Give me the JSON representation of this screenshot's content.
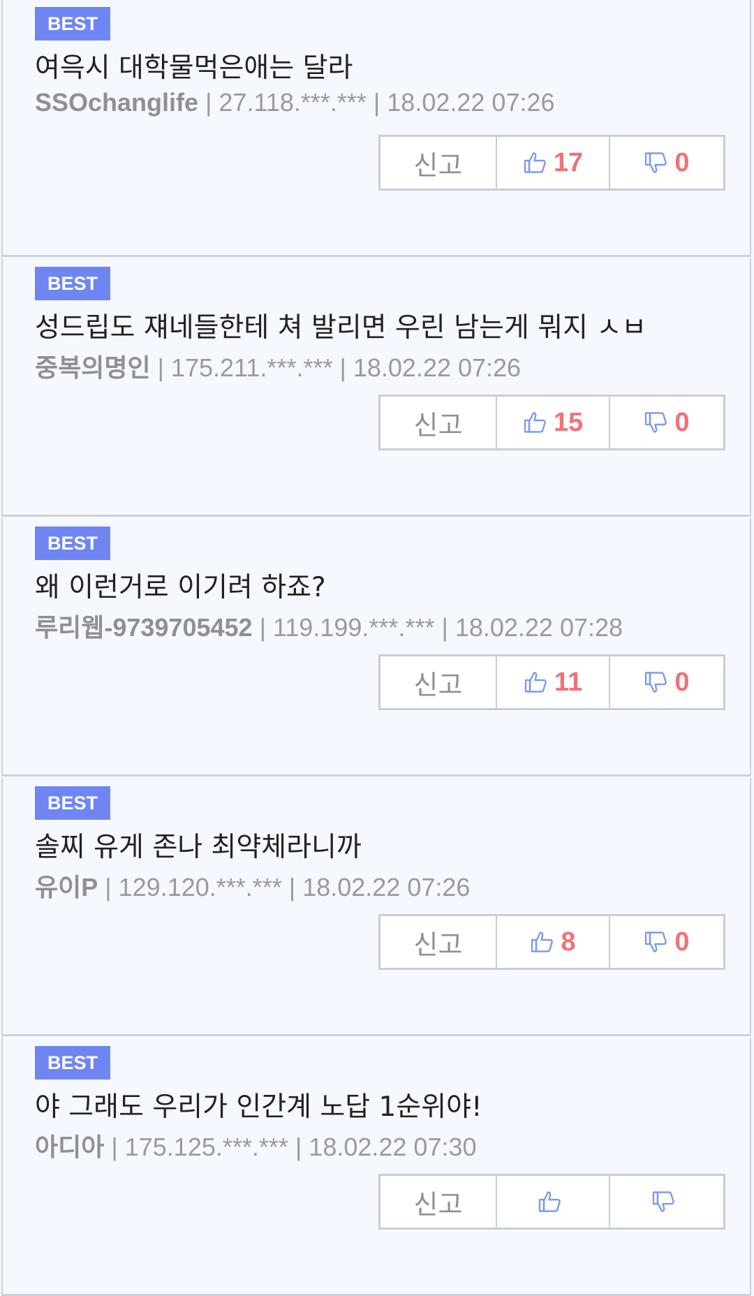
{
  "comments": [
    {
      "badge": "BEST",
      "text": "여윽시 대학물먹은애는 달라",
      "author": "SSOchanglife",
      "ip": "27.118.***.***",
      "date": "18.02.22 07:26",
      "report_label": "신고",
      "likes": "17",
      "dislikes": "0"
    },
    {
      "badge": "BEST",
      "text": "성드립도 쟤네들한테 쳐 발리면 우린 남는게 뭐지 ㅅㅂ",
      "author": "중복의명인",
      "ip": "175.211.***.***",
      "date": "18.02.22 07:26",
      "report_label": "신고",
      "likes": "15",
      "dislikes": "0"
    },
    {
      "badge": "BEST",
      "text": "왜 이런거로 이기려 하죠?",
      "author": "루리웹-9739705452",
      "ip": "119.199.***.***",
      "date": "18.02.22 07:28",
      "report_label": "신고",
      "likes": "11",
      "dislikes": "0"
    },
    {
      "badge": "BEST",
      "text": "솔찌 유게 존나 최약체라니까",
      "author": "유이P",
      "ip": "129.120.***.***",
      "date": "18.02.22 07:26",
      "report_label": "신고",
      "likes": "8",
      "dislikes": "0"
    },
    {
      "badge": "BEST",
      "text": "야 그래도 우리가 인간계 노답 1순위야!",
      "author": "아디아",
      "ip": "175.125.***.***",
      "date": "18.02.22 07:30",
      "report_label": "신고",
      "likes": "",
      "dislikes": ""
    }
  ],
  "separator": " | ",
  "colors": {
    "badge": "#6f86f2",
    "count": "#f07278",
    "icon": "#7b9bee",
    "border": "#cacdd3"
  },
  "icons": {
    "like": "thumbs-up-icon",
    "dislike": "thumbs-down-icon"
  }
}
